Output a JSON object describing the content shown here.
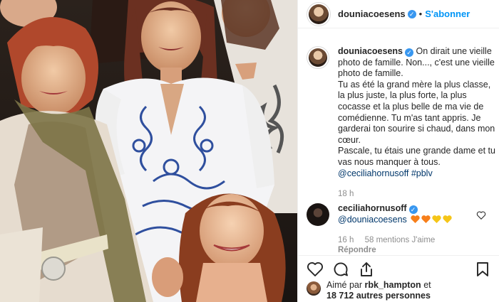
{
  "header": {
    "username": "douniacoesens",
    "verified_glyph": "✓",
    "separator": "•",
    "follow_label": "S'abonner"
  },
  "caption": {
    "username": "douniacoesens",
    "text_intro": "On dirait une vieille photo de famille. Non..., c'est une vieille photo de famille.",
    "text_body": "Tu as été la grand mère la plus classe, la plus juste, la plus forte, la plus cocasse et la plus belle de ma vie de comédienne. Tu m'as tant appris. Je garderai ton sourire si chaud, dans mon cœur.",
    "text_closing": "Pascale, tu étais une grande dame et tu vas nous manquer à tous.",
    "mention": "@ceciliahornusoff",
    "hashtag": "#pblv",
    "time": "18 h"
  },
  "comment": {
    "username": "ceciliahornusoff",
    "mention": "@douniacoesens",
    "emojis": [
      "#f77f1a",
      "#f77f1a",
      "#f5c518",
      "#f5c518"
    ],
    "time": "16 h",
    "likes_label": "58 mentions J'aime",
    "reply_label": "Répondre"
  },
  "actions": {
    "icons": [
      "heart-icon",
      "comment-icon",
      "share-icon",
      "bookmark-icon"
    ]
  },
  "likes": {
    "prefix": "Aimé par",
    "user": "rbk_hampton",
    "connector": "et",
    "others": "18 712 autres personnes"
  },
  "colors": {
    "link": "#00376b",
    "accent": "#0095f6",
    "verified": "#3897f0",
    "muted": "#8e8e8e"
  }
}
